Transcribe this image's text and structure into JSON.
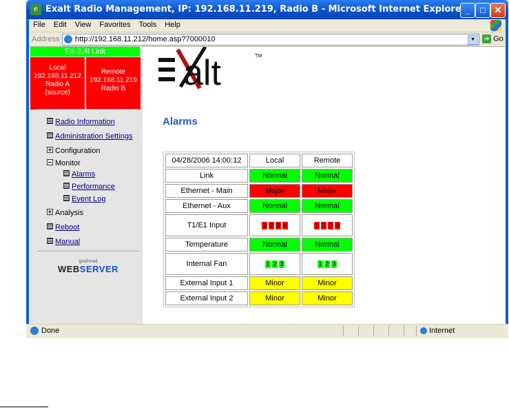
{
  "window": {
    "title": "Exalt Radio Management, IP: 192.168.11.219, Radio B - Microsoft Internet Explorer",
    "buttons": {
      "minimize": "_",
      "maximize": "□",
      "close": "✕"
    }
  },
  "menubar": [
    "File",
    "Edit",
    "View",
    "Favorites",
    "Tools",
    "Help"
  ],
  "address": {
    "label": "Address",
    "url": "http://192.168.11.212/home.asp?7000010",
    "go": "Go"
  },
  "sidebar": {
    "link_status": "EX-2.4i Link",
    "local": [
      "Local",
      "192.168.11.212",
      "Radio A",
      "(source)"
    ],
    "remote": [
      "Remote",
      "192.168.11.219",
      "Radio B"
    ],
    "nav": {
      "radio_info": "Radio Information",
      "admin": "Administration Settings",
      "configuration": "Configuration",
      "monitor": "Monitor",
      "alarms": "Alarms",
      "performance": "Performance",
      "event_log": "Event Log",
      "analysis": "Analysis",
      "reboot": "Reboot",
      "manual": "Manual"
    },
    "webserver": {
      "small": "goahead",
      "web": "WEB",
      "server": "SERVER"
    }
  },
  "logo": {
    "text": "alt",
    "tm": "TM"
  },
  "page_title": "Alarms",
  "alarms": {
    "timestamp": "04/28/2006 14:00:12",
    "col_local": "Local",
    "col_remote": "Remote",
    "rows": {
      "link": {
        "label": "Link",
        "local": "Normal",
        "remote": "Normal"
      },
      "eth_main": {
        "label": "Ethernet - Main",
        "local": "Major",
        "remote": "Major"
      },
      "eth_aux": {
        "label": "Ethernet - Aux",
        "local": "Normal",
        "remote": "Normal"
      },
      "t1e1": {
        "label": "T1/E1 Input",
        "local": [
          "1",
          "2",
          "3",
          "4"
        ],
        "remote": [
          "1",
          "2",
          "3",
          "4"
        ]
      },
      "temp": {
        "label": "Temperature",
        "local": "Normal",
        "remote": "Normal"
      },
      "fan": {
        "label": "Internal Fan",
        "local": [
          "1",
          "2",
          "3"
        ],
        "remote": [
          "1",
          "2",
          "3"
        ]
      },
      "ext1": {
        "label": "External Input 1",
        "local": "Minor",
        "remote": "Minor"
      },
      "ext2": {
        "label": "External Input 2",
        "local": "Minor",
        "remote": "Minor"
      }
    }
  },
  "status": {
    "text": "Done",
    "zone": "Internet"
  },
  "colors": {
    "normal": "#00ff00",
    "major": "#ff0000",
    "minor": "#ffff00",
    "accent": "#1a5fbf"
  }
}
